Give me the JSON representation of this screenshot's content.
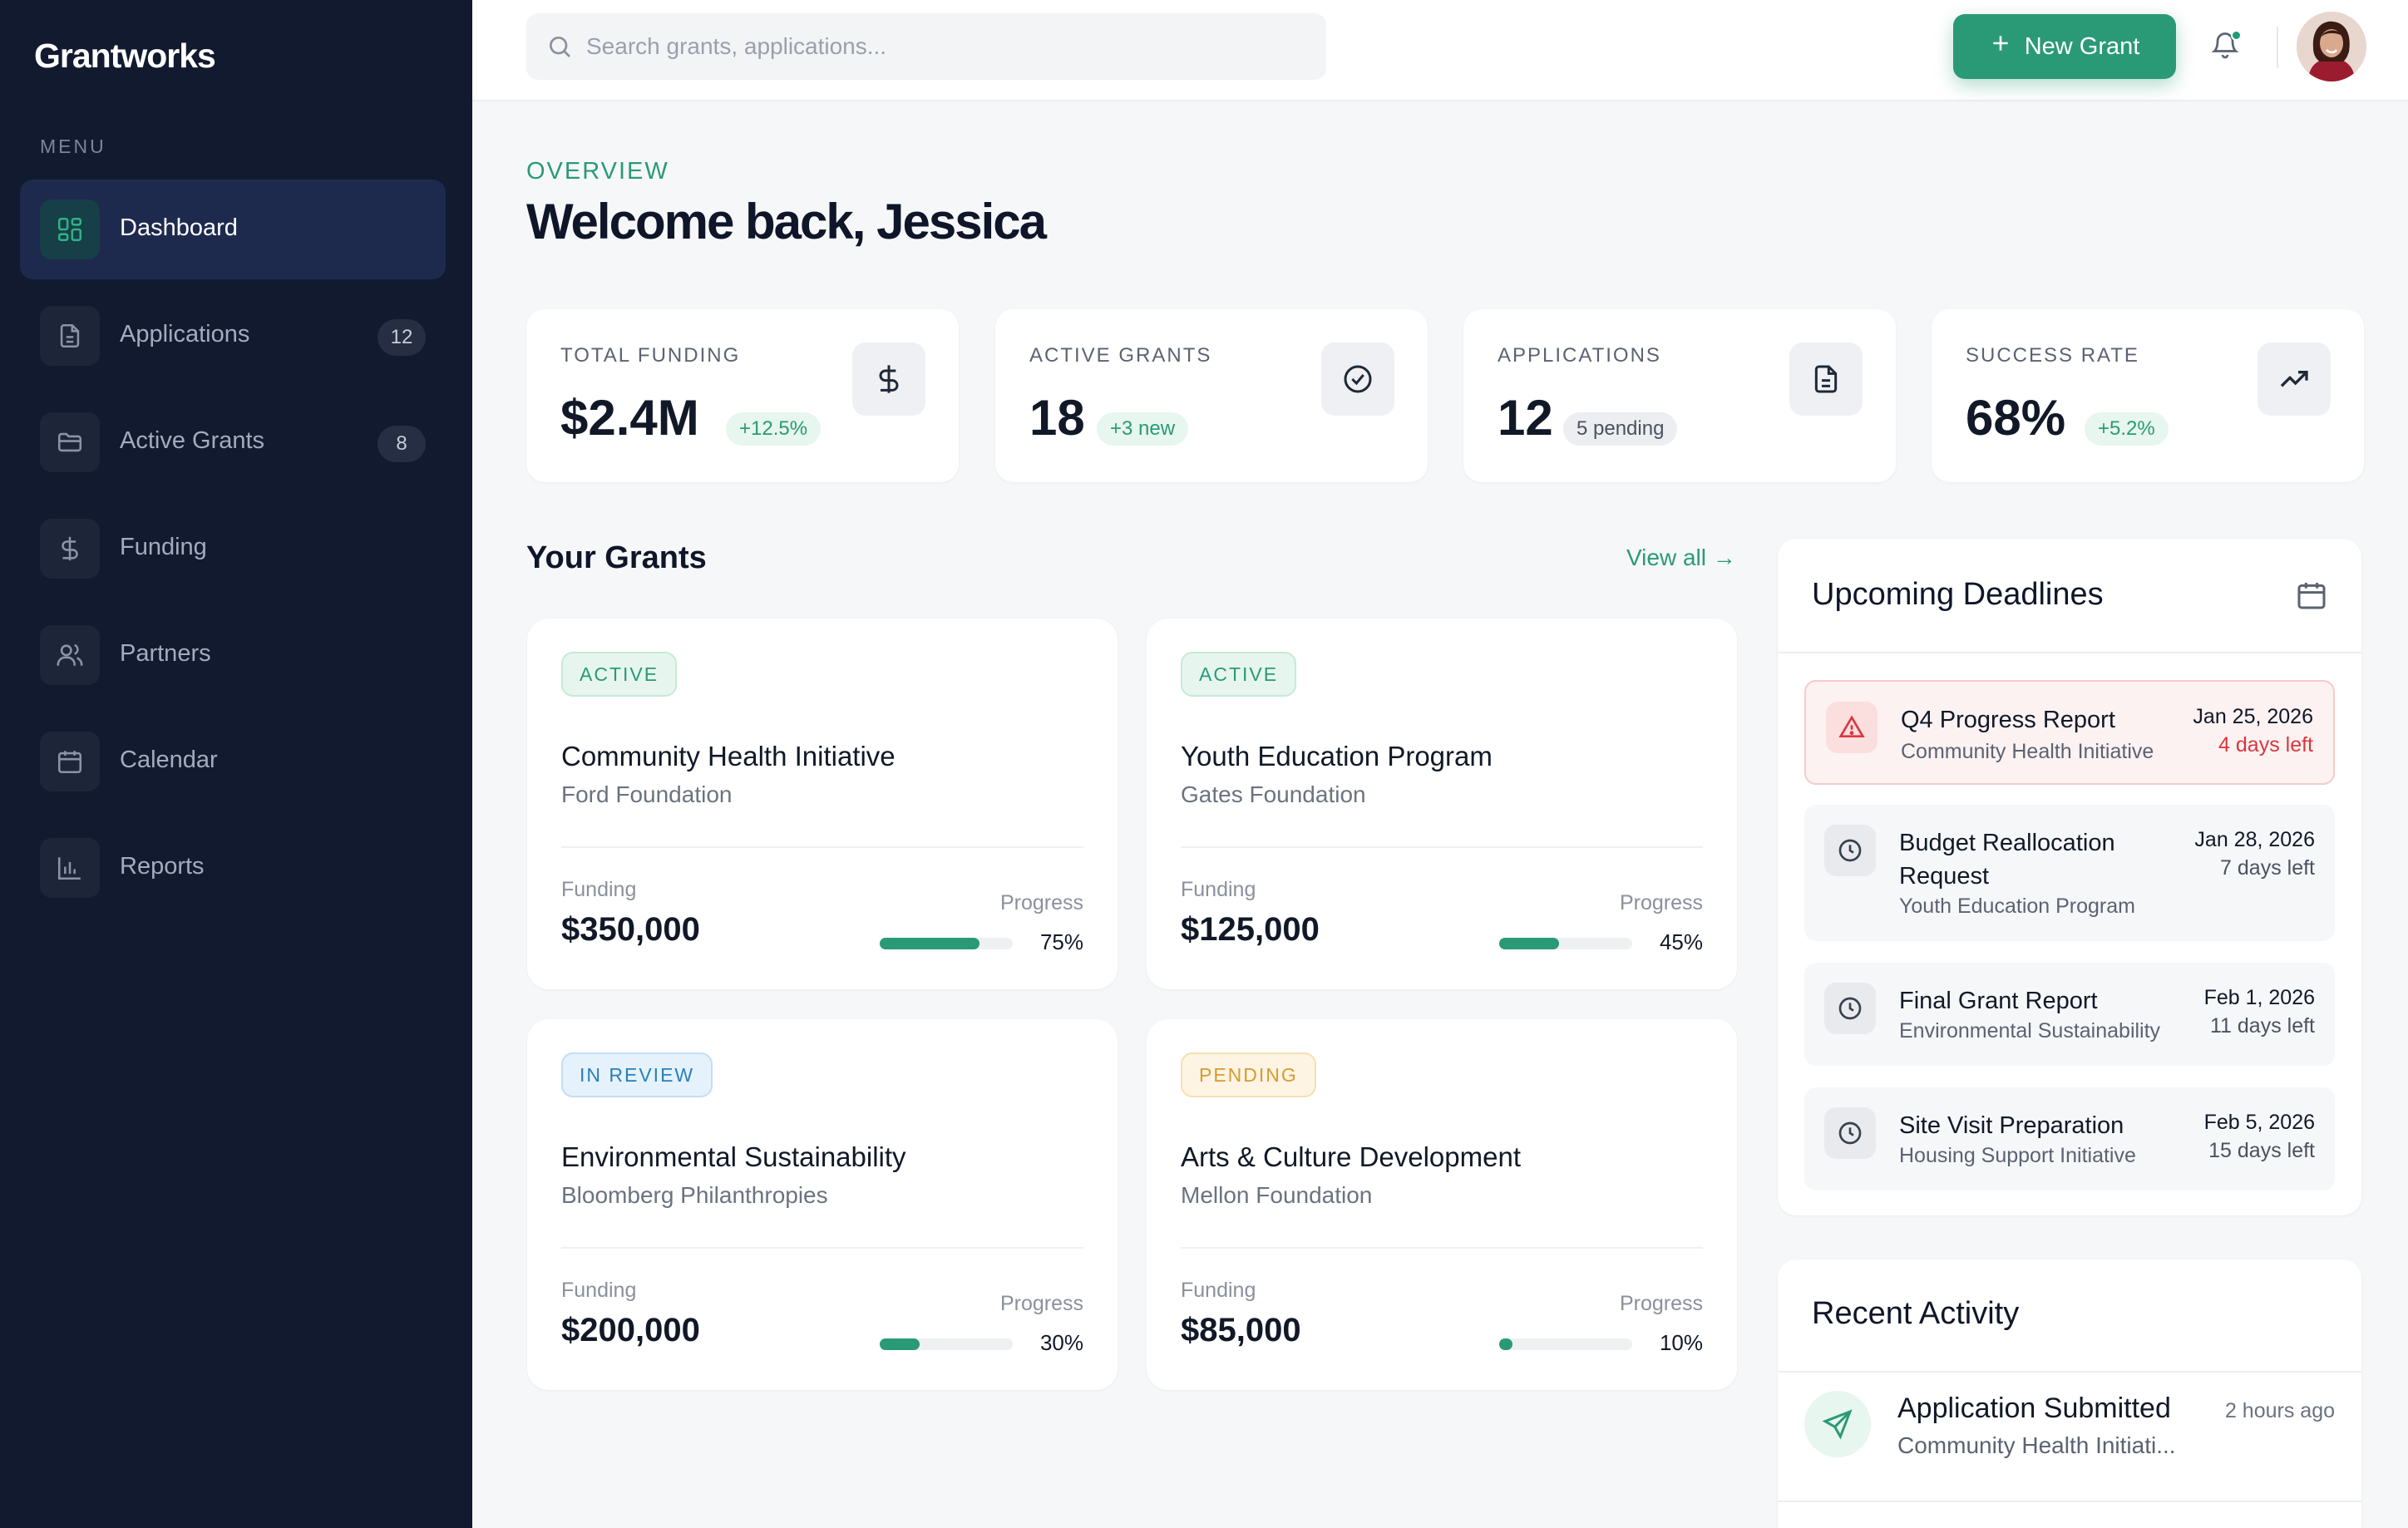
{
  "brand": "Grantworks",
  "menu_label": "MENU",
  "nav": [
    {
      "label": "Dashboard",
      "icon": "grid-icon",
      "active": true,
      "badge": ""
    },
    {
      "label": "Applications",
      "icon": "document-icon",
      "badge": "12"
    },
    {
      "label": "Active Grants",
      "icon": "folder-icon",
      "badge": "8"
    },
    {
      "label": "Funding",
      "icon": "dollar-icon",
      "badge": ""
    },
    {
      "label": "Partners",
      "icon": "users-icon",
      "badge": ""
    },
    {
      "label": "Calendar",
      "icon": "calendar-icon",
      "badge": ""
    },
    {
      "label": "Reports",
      "icon": "bar-chart-icon",
      "badge": ""
    }
  ],
  "search": {
    "placeholder": "Search grants, applications...",
    "value": ""
  },
  "header": {
    "new_grant_label": "New Grant"
  },
  "overview": {
    "eyebrow": "OVERVIEW",
    "welcome": "Welcome back, Jessica"
  },
  "stats": [
    {
      "label": "TOTAL FUNDING",
      "value": "$2.4M",
      "chip": "+12.5%",
      "chip_style": "green",
      "icon": "dollar-icon"
    },
    {
      "label": "ACTIVE GRANTS",
      "value": "18",
      "chip": "+3 new",
      "chip_style": "green",
      "icon": "check-circle-icon"
    },
    {
      "label": "APPLICATIONS",
      "value": "12",
      "chip": "5 pending",
      "chip_style": "gray",
      "icon": "document-icon"
    },
    {
      "label": "SUCCESS RATE",
      "value": "68%",
      "chip": "+5.2%",
      "chip_style": "green",
      "icon": "trending-up-icon"
    }
  ],
  "grants_section": {
    "title": "Your Grants",
    "view_all": "View all →"
  },
  "grants": [
    {
      "status": "ACTIVE",
      "status_style": "active",
      "title": "Community Health Initiative",
      "org": "Ford Foundation",
      "funding_label": "Funding",
      "funding": "$350,000",
      "progress_label": "Progress",
      "progress": "75%",
      "progress_fraction": 0.75
    },
    {
      "status": "ACTIVE",
      "status_style": "active",
      "title": "Youth Education Program",
      "org": "Gates Foundation",
      "funding_label": "Funding",
      "funding": "$125,000",
      "progress_label": "Progress",
      "progress": "45%",
      "progress_fraction": 0.45
    },
    {
      "status": "IN REVIEW",
      "status_style": "review",
      "title": "Environmental Sustainability",
      "org": "Bloomberg Philanthropies",
      "funding_label": "Funding",
      "funding": "$200,000",
      "progress_label": "Progress",
      "progress": "30%",
      "progress_fraction": 0.3
    },
    {
      "status": "PENDING",
      "status_style": "pending",
      "title": "Arts & Culture Development",
      "org": "Mellon Foundation",
      "funding_label": "Funding",
      "funding": "$85,000",
      "progress_label": "Progress",
      "progress": "10%",
      "progress_fraction": 0.1
    }
  ],
  "deadlines": {
    "title": "Upcoming Deadlines",
    "items": [
      {
        "title": "Q4 Progress Report",
        "sub": "Community Health Initiative",
        "date": "Jan 25, 2026",
        "left": "4 days left",
        "urgent": true,
        "icon": "alert-triangle-icon"
      },
      {
        "title": "Budget Reallocation Request",
        "sub": "Youth Education Program",
        "date": "Jan 28, 2026",
        "left": "7 days left",
        "urgent": false,
        "icon": "clock-icon"
      },
      {
        "title": "Final Grant Report",
        "sub": "Environmental Sustainability",
        "date": "Feb 1, 2026",
        "left": "11 days left",
        "urgent": false,
        "icon": "clock-icon"
      },
      {
        "title": "Site Visit Preparation",
        "sub": "Housing Support Initiative",
        "date": "Feb 5, 2026",
        "left": "15 days left",
        "urgent": false,
        "icon": "clock-icon"
      }
    ]
  },
  "activity": {
    "title": "Recent Activity",
    "items": [
      {
        "title": "Application Submitted",
        "sub": "Community Health Initiati...",
        "time": "2 hours ago",
        "icon": "send-icon"
      }
    ]
  },
  "colors": {
    "accent": "#2a9a76",
    "sidebar": "#121a30",
    "danger": "#d9363e"
  }
}
